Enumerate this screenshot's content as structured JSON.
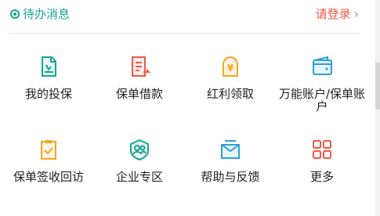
{
  "header": {
    "title": "待办消息",
    "login": "请登录",
    "login_chevron": "›",
    "accent": "#16a592",
    "login_color": "#ef5a4a"
  },
  "grid": {
    "items": [
      {
        "label": "我的投保",
        "icon": "policy-document-icon",
        "color": "#16a592"
      },
      {
        "label": "保单借款",
        "icon": "policy-loan-icon",
        "color": "#ef5a4a"
      },
      {
        "label": "红利领取",
        "icon": "bonus-yuan-icon",
        "color": "#f5a623"
      },
      {
        "label": "万能账户/保单账户",
        "icon": "wallet-icon",
        "color": "#2aa0d8"
      },
      {
        "label": "保单签收回访",
        "icon": "clipboard-check-icon",
        "color": "#f5a623"
      },
      {
        "label": "企业专区",
        "icon": "enterprise-group-icon",
        "color": "#16a592"
      },
      {
        "label": "帮助与反馈",
        "icon": "help-mail-icon",
        "color": "#2aa0d8"
      },
      {
        "label": "更多",
        "icon": "more-grid-icon",
        "color": "#ef5a4a"
      }
    ]
  }
}
